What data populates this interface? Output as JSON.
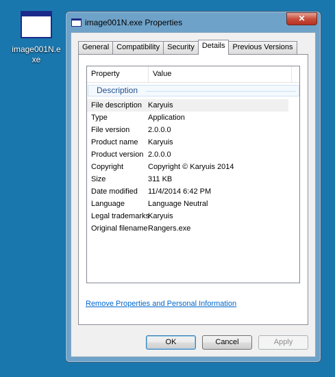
{
  "desktop": {
    "icon_label": "image001N.e xe"
  },
  "window": {
    "title": "image001N.exe Properties",
    "close_glyph": "✕",
    "tabs": [
      {
        "label": "General"
      },
      {
        "label": "Compatibility"
      },
      {
        "label": "Security"
      },
      {
        "label": "Details"
      },
      {
        "label": "Previous Versions"
      }
    ],
    "active_tab": "Details",
    "list": {
      "col_property": "Property",
      "col_value": "Value",
      "group": "Description",
      "rows": [
        {
          "k": "File description",
          "v": "Karyuis"
        },
        {
          "k": "Type",
          "v": "Application"
        },
        {
          "k": "File version",
          "v": "2.0.0.0"
        },
        {
          "k": "Product name",
          "v": "Karyuis"
        },
        {
          "k": "Product version",
          "v": "2.0.0.0"
        },
        {
          "k": "Copyright",
          "v": "Copyright © Karyuis 2014"
        },
        {
          "k": "Size",
          "v": "311 KB"
        },
        {
          "k": "Date modified",
          "v": "11/4/2014 6:42 PM"
        },
        {
          "k": "Language",
          "v": "Language Neutral"
        },
        {
          "k": "Legal trademarks",
          "v": "Karyuis"
        },
        {
          "k": "Original filename",
          "v": "Rangers.exe"
        }
      ]
    },
    "remove_link": "Remove Properties and Personal Information",
    "buttons": {
      "ok": "OK",
      "cancel": "Cancel",
      "apply": "Apply"
    }
  },
  "icons": {
    "desktop_file": "exe-file-icon",
    "title_icon": "exe-file-icon",
    "close": "close-icon"
  }
}
